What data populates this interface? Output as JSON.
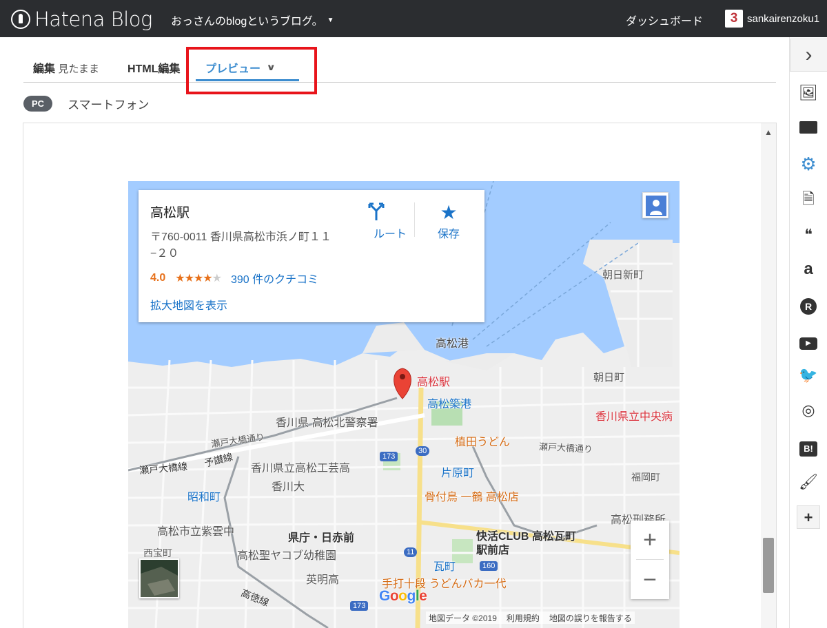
{
  "topbar": {
    "logo_text": "Hatena Blog",
    "blog_name": "おっさんのblogというブログ。",
    "dashboard_label": "ダッシュボード",
    "user_badge": "3",
    "username": "sankairenzoku1"
  },
  "tabs": {
    "edit_label": "編集",
    "edit_sub": "見たまま",
    "html_label": "HTML編集",
    "preview_label": "プレビュー"
  },
  "device": {
    "pc_label": "PC",
    "smartphone_label": "スマートフォン"
  },
  "map": {
    "card": {
      "title": "高松駅",
      "address": "〒760-0011 香川県高松市浜ノ町１１−２０",
      "rating": "4.0",
      "stars_filled": "★★★★",
      "stars_empty": "★",
      "reviews": "390 件のクチコミ",
      "enlarge": "拡大地図を表示",
      "route_label": "ルート",
      "save_label": "保存"
    },
    "labels": {
      "station": "高松駅",
      "port": "高松港",
      "chikko": "高松築港",
      "police": "香川県 高松北警察署",
      "udon": "植田うどん",
      "hospital": "香川県立中央病",
      "asahishin": "朝日新町",
      "asahi": "朝日町",
      "setoohashi_dori": "瀬戸大橋通り",
      "setoohashi_dori2": "瀬戸大橋通り",
      "setoohashi_line": "瀬戸大橋線",
      "yosan_line": "予讃線",
      "kogei": "香川県立高松工芸高",
      "kagawa_univ": "香川大",
      "katahara": "片原町",
      "honetsuki": "骨付鳥 一鶴 高松店",
      "fukuoka": "福岡町",
      "showa": "昭和町",
      "keimusho": "高松刑務所",
      "shiritsu": "高松市立紫雲中",
      "kencho": "県庁・日赤前",
      "kaikatsu": "快活CLUB 高松瓦町駅前店",
      "nishiho": "西宝町",
      "jacob": "高松聖ヤコブ幼稚園",
      "kawaramachi": "瓦町",
      "eimei": "英明高",
      "teuchi": "手打十段 うどんバカ一代",
      "takatoku": "高徳線",
      "route_173": "173",
      "route_30": "30",
      "route_11": "11",
      "route_160": "160",
      "route_173b": "173"
    },
    "attribution": {
      "data": "地図データ ©2019",
      "terms": "利用規約",
      "report": "地図の誤りを報告する"
    },
    "google_letters": [
      "G",
      "o",
      "o",
      "g",
      "l",
      "e"
    ],
    "google_colors": [
      "#4285f4",
      "#ea4335",
      "#fbbc05",
      "#4285f4",
      "#34a853",
      "#ea4335"
    ],
    "zoom_in": "+",
    "zoom_out": "−"
  },
  "colors": {
    "topbar": "#2b2d30",
    "accent": "#3b8ccf",
    "highlight": "#e8141b",
    "water": "#a3ccff",
    "star": "#e7711b"
  },
  "sidebar": {
    "icons": [
      "photo-icon",
      "folder-icon",
      "gear-icon",
      "document-icon",
      "quote-icon",
      "amazon-icon",
      "rakuten-icon",
      "youtube-icon",
      "twitter-icon",
      "instagram-icon",
      "hatena-bookmark-icon",
      "brush-icon",
      "plus-icon"
    ]
  }
}
